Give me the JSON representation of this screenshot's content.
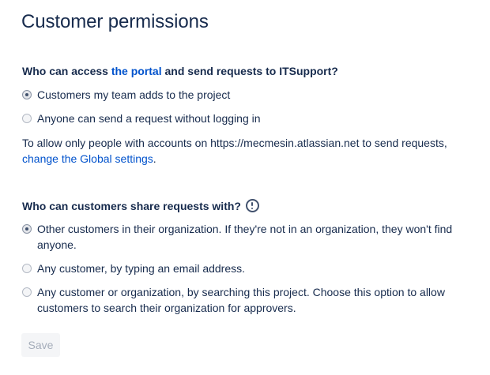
{
  "page": {
    "title": "Customer permissions"
  },
  "access": {
    "heading_prefix": "Who can access ",
    "heading_link": "the portal",
    "heading_suffix": " and send requests to ITSupport?",
    "options": [
      {
        "label": "Customers my team adds to the project",
        "checked": true
      },
      {
        "label": "Anyone can send a request without logging in",
        "checked": false
      }
    ],
    "info_text": "To allow only people with accounts on https://mecmesin.atlassian.net to send requests,",
    "info_link": "change the Global settings",
    "info_suffix": "."
  },
  "sharing": {
    "heading": "Who can customers share requests with?",
    "help_icon": "exclamation-circle-icon",
    "options": [
      {
        "label": "Other customers in their organization. If they're not in an organization, they won't find anyone.",
        "checked": true
      },
      {
        "label": "Any customer, by typing an email address.",
        "checked": false
      },
      {
        "label": "Any customer or organization, by searching this project. Choose this option to allow customers to search their organization for approvers.",
        "checked": false
      }
    ]
  },
  "actions": {
    "save_label": "Save",
    "save_disabled": true
  },
  "colors": {
    "text": "#172b4d",
    "link": "#0052cc",
    "disabled_button_bg": "#f4f5f7",
    "disabled_button_text": "#a5adba"
  }
}
